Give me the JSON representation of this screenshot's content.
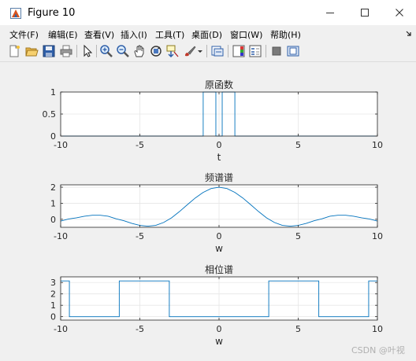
{
  "window": {
    "title": "Figure 10"
  },
  "menu": [
    "文件(F)",
    "编辑(E)",
    "查看(V)",
    "插入(I)",
    "工具(T)",
    "桌面(D)",
    "窗口(W)",
    "帮助(H)"
  ],
  "toolbar": [
    "new-figure-icon",
    "open-file-icon",
    "save-icon",
    "print-icon",
    "select-arrow-icon",
    "zoom-in-icon",
    "zoom-out-icon",
    "pan-hand-icon",
    "rotate-3d-icon",
    "data-cursor-icon",
    "brush-icon",
    "dropdown-arrow-icon",
    "link-plot-icon",
    "insert-colorbar-icon",
    "insert-legend-icon",
    "hide-plot-tools-icon",
    "show-plot-tools-icon"
  ],
  "watermark": "CSDN @叶视",
  "colors": {
    "line": "#0072bd",
    "axes_bg": "#ffffff",
    "figure_bg": "#f0f0f0",
    "grid": "#e6e6e6"
  },
  "chart_data": [
    {
      "type": "line",
      "title": "原函数",
      "xlabel": "t",
      "ylabel": "",
      "xlim": [
        -10,
        10
      ],
      "ylim": [
        0,
        1
      ],
      "xticks": [
        -10,
        -5,
        0,
        5,
        10
      ],
      "yticks": [
        0,
        0.5,
        1
      ],
      "ytick_labels": [
        "0",
        "0.5",
        "1"
      ],
      "grid": true,
      "series": [
        {
          "x": [
            -10,
            -1,
            -1,
            -0.2,
            -0.2,
            0.2,
            0.2,
            1,
            1,
            10
          ],
          "y": [
            0,
            0,
            1,
            1,
            0,
            0,
            1,
            1,
            0,
            0
          ]
        }
      ]
    },
    {
      "type": "line",
      "title": "频谱谱",
      "xlabel": "w",
      "ylabel": "",
      "xlim": [
        -10,
        10
      ],
      "ylim": [
        -0.5,
        2.15
      ],
      "xticks": [
        -10,
        -5,
        0,
        5,
        10
      ],
      "yticks": [
        0,
        1,
        2
      ],
      "ytick_labels": [
        "0",
        "1",
        "2"
      ],
      "grid": true,
      "series": [
        {
          "x": [
            -10,
            -9.5,
            -9,
            -8.5,
            -8,
            -7.5,
            -7,
            -6.5,
            -6,
            -5.5,
            -5,
            -4.5,
            -4,
            -3.5,
            -3,
            -2.5,
            -2,
            -1.5,
            -1,
            -0.5,
            0,
            0.5,
            1,
            1.5,
            2,
            2.5,
            3,
            3.5,
            4,
            4.5,
            5,
            5.5,
            6,
            6.5,
            7,
            7.5,
            8,
            8.5,
            9,
            9.5,
            10
          ],
          "y": [
            -0.11,
            0.02,
            0.09,
            0.19,
            0.25,
            0.25,
            0.19,
            0.03,
            -0.09,
            -0.26,
            -0.38,
            -0.43,
            -0.38,
            -0.2,
            0.09,
            0.48,
            0.91,
            1.33,
            1.68,
            1.92,
            2.0,
            1.92,
            1.68,
            1.33,
            0.91,
            0.48,
            0.09,
            -0.2,
            -0.38,
            -0.43,
            -0.38,
            -0.26,
            -0.09,
            0.03,
            0.19,
            0.25,
            0.25,
            0.19,
            0.09,
            0.02,
            -0.11
          ]
        }
      ]
    },
    {
      "type": "line",
      "title": "相位谱",
      "xlabel": "w",
      "ylabel": "",
      "xlim": [
        -10,
        10
      ],
      "ylim": [
        -0.3,
        3.5
      ],
      "xticks": [
        -10,
        -5,
        0,
        5,
        10
      ],
      "yticks": [
        0,
        1,
        2,
        3
      ],
      "ytick_labels": [
        "0",
        "1",
        "2",
        "3"
      ],
      "grid": true,
      "series": [
        {
          "x": [
            -10,
            -9.45,
            -9.45,
            -6.3,
            -6.3,
            -3.14,
            -3.14,
            3.14,
            3.14,
            6.3,
            6.3,
            9.45,
            9.45,
            10
          ],
          "y": [
            3.14,
            3.14,
            0,
            0,
            3.14,
            3.14,
            0,
            0,
            3.14,
            3.14,
            0,
            0,
            3.14,
            3.14
          ]
        }
      ]
    }
  ]
}
